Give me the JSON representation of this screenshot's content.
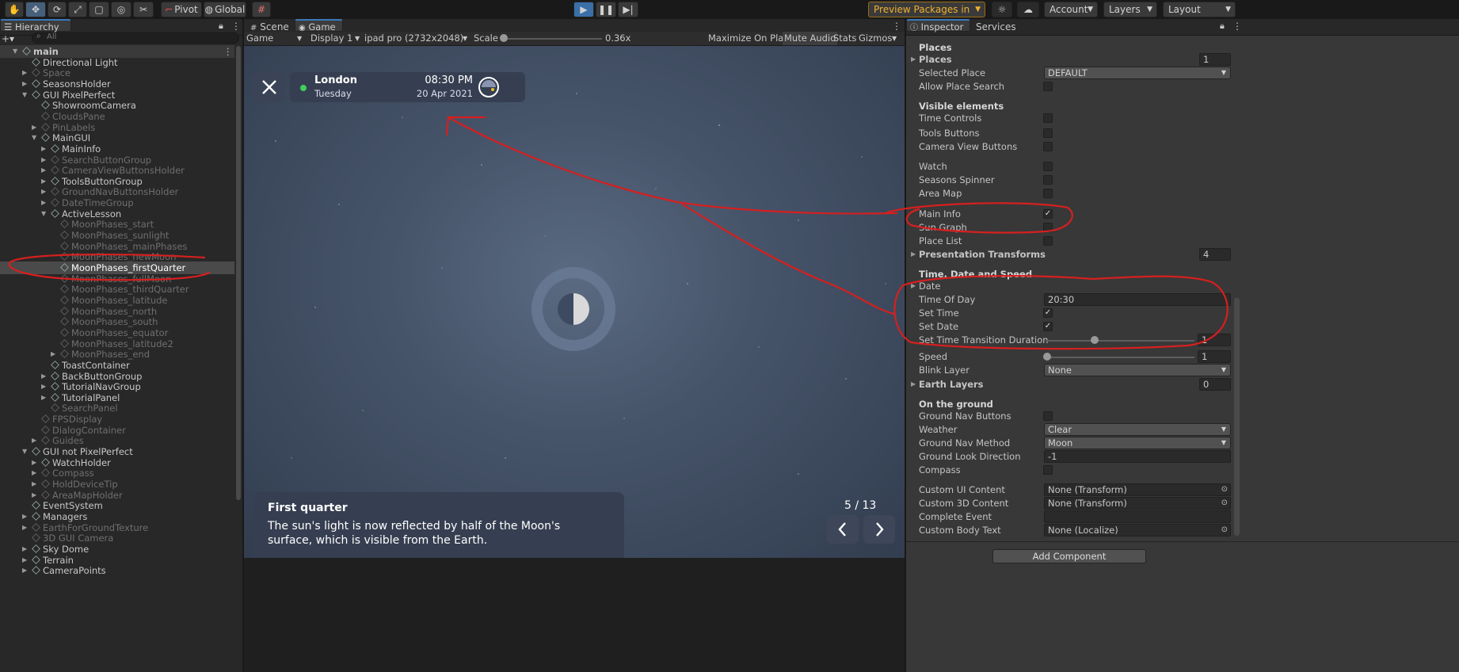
{
  "toolbar": {
    "pivot": "Pivot",
    "global": "Global",
    "preview_packages": "Preview Packages in Use",
    "account": "Account",
    "layers": "Layers",
    "layout": "Layout"
  },
  "hierarchy": {
    "tab": "Hierarchy",
    "search_placeholder": "All",
    "rows": [
      {
        "label": "main",
        "dim": false,
        "bold": true
      },
      {
        "label": "Directional Light",
        "dim": false
      },
      {
        "label": "Space",
        "dim": true
      },
      {
        "label": "SeasonsHolder",
        "dim": false
      },
      {
        "label": "GUI PixelPerfect",
        "dim": false
      },
      {
        "label": "ShowroomCamera",
        "dim": false
      },
      {
        "label": "CloudsPane",
        "dim": true
      },
      {
        "label": "PinLabels",
        "dim": true
      },
      {
        "label": "MainGUI",
        "dim": false
      },
      {
        "label": "MainInfo",
        "dim": false
      },
      {
        "label": "SearchButtonGroup",
        "dim": true
      },
      {
        "label": "CameraViewButtonsHolder",
        "dim": true
      },
      {
        "label": "ToolsButtonGroup",
        "dim": false
      },
      {
        "label": "GroundNavButtonsHolder",
        "dim": true
      },
      {
        "label": "DateTimeGroup",
        "dim": true
      },
      {
        "label": "ActiveLesson",
        "dim": false
      },
      {
        "label": "MoonPhases_start",
        "dim": true
      },
      {
        "label": "MoonPhases_sunlight",
        "dim": true
      },
      {
        "label": "MoonPhases_mainPhases",
        "dim": true
      },
      {
        "label": "MoonPhases_newMoon",
        "dim": true
      },
      {
        "label": "MoonPhases_firstQuarter",
        "dim": false,
        "selected": true
      },
      {
        "label": "MoonPhases_fullMoon",
        "dim": true
      },
      {
        "label": "MoonPhases_thirdQuarter",
        "dim": true
      },
      {
        "label": "MoonPhases_latitude",
        "dim": true
      },
      {
        "label": "MoonPhases_north",
        "dim": true
      },
      {
        "label": "MoonPhases_south",
        "dim": true
      },
      {
        "label": "MoonPhases_equator",
        "dim": true
      },
      {
        "label": "MoonPhases_latitude2",
        "dim": true
      },
      {
        "label": "MoonPhases_end",
        "dim": true
      },
      {
        "label": "ToastContainer",
        "dim": false
      },
      {
        "label": "BackButtonGroup",
        "dim": false
      },
      {
        "label": "TutorialNavGroup",
        "dim": false
      },
      {
        "label": "TutorialPanel",
        "dim": false
      },
      {
        "label": "SearchPanel",
        "dim": true
      },
      {
        "label": "FPSDisplay",
        "dim": true
      },
      {
        "label": "DialogContainer",
        "dim": true
      },
      {
        "label": "Guides",
        "dim": true
      },
      {
        "label": "GUI not PixelPerfect",
        "dim": false
      },
      {
        "label": "WatchHolder",
        "dim": false
      },
      {
        "label": "Compass",
        "dim": true
      },
      {
        "label": "HoldDeviceTip",
        "dim": true
      },
      {
        "label": "AreaMapHolder",
        "dim": true
      },
      {
        "label": "EventSystem",
        "dim": false
      },
      {
        "label": "Managers",
        "dim": false
      },
      {
        "label": "EarthForGroundTexture",
        "dim": true
      },
      {
        "label": "3D GUI Camera",
        "dim": true
      },
      {
        "label": "Sky Dome",
        "dim": false
      },
      {
        "label": "Terrain",
        "dim": false
      },
      {
        "label": "CameraPoints",
        "dim": false
      }
    ]
  },
  "game_view": {
    "tab_scene": "Scene",
    "tab_game": "Game",
    "mode": "Game",
    "display": "Display 1",
    "resolution": "ipad pro (2732x2048)",
    "scale_label": "Scale",
    "scale_value": "0.36x",
    "maximize": "Maximize On Play",
    "mute": "Mute Audio",
    "stats": "Stats",
    "gizmos": "Gizmos",
    "city": "London",
    "weekday": "Tuesday",
    "time": "08:30 PM",
    "date": "20 Apr 2021",
    "lesson_title": "First quarter",
    "lesson_text_1": "The sun's light is now reflected by half of the Moon's",
    "lesson_text_2": "surface, which is visible from the Earth.",
    "page": "5 / 13"
  },
  "inspector": {
    "tab_inspector": "Inspector",
    "tab_services": "Services",
    "places_header": "Places",
    "places": "Places",
    "places_value": "1",
    "selected_place": "Selected Place",
    "selected_place_value": "DEFAULT",
    "allow_place_search": "Allow Place Search",
    "visible_elements": "Visible elements",
    "time_controls": "Time Controls",
    "tools_buttons": "Tools Buttons",
    "camera_view_buttons": "Camera View Buttons",
    "watch": "Watch",
    "seasons_spinner": "Seasons Spinner",
    "area_map": "Area Map",
    "main_info": "Main Info",
    "sun_graph": "Sun Graph",
    "place_list": "Place List",
    "presentation_transforms": "Presentation Transforms",
    "presentation_value": "4",
    "time_date_speed": "Time, Date and Speed",
    "date": "Date",
    "time_of_day": "Time Of Day",
    "time_of_day_value": "20:30",
    "set_time": "Set Time",
    "set_date": "Set Date",
    "set_time_transition": "Set Time Transition Duration",
    "set_time_transition_value": "1",
    "speed": "Speed",
    "speed_value": "1",
    "blink_layer": "Blink Layer",
    "blink_layer_value": "None",
    "earth_layers": "Earth Layers",
    "earth_layers_value": "0",
    "on_the_ground": "On the ground",
    "ground_nav_buttons": "Ground Nav Buttons",
    "weather": "Weather",
    "weather_value": "Clear",
    "ground_nav_method": "Ground Nav Method",
    "ground_nav_method_value": "Moon",
    "ground_look_direction": "Ground Look Direction",
    "ground_look_direction_value": "-1",
    "compass": "Compass",
    "custom_ui_content": "Custom UI Content",
    "custom_ui_content_value": "None (Transform)",
    "custom_3d_content": "Custom 3D Content",
    "custom_3d_content_value": "None (Transform)",
    "complete_event": "Complete Event",
    "custom_body_text": "Custom Body Text",
    "custom_body_text_value": "None (Localize)",
    "add_component": "Add Component"
  }
}
